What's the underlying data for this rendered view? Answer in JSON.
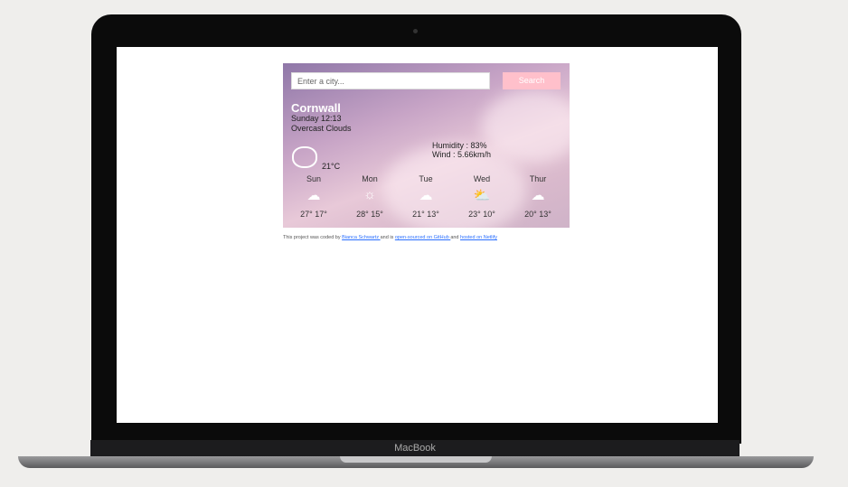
{
  "device": {
    "brand": "MacBook"
  },
  "search": {
    "placeholder": "Enter a city...",
    "button": "Search"
  },
  "current": {
    "city": "Cornwall",
    "datetime": "Sunday 12:13",
    "description": "Overcast Clouds",
    "temperature": "21°C",
    "humidity": "Humidity : 83%",
    "wind": "Wind : 5.66km/h",
    "icon": "cloud-icon"
  },
  "forecast": [
    {
      "day": "Sun",
      "icon": "cloud-icon",
      "temps": "27° 17°"
    },
    {
      "day": "Mon",
      "icon": "sun-icon",
      "temps": "28° 15°"
    },
    {
      "day": "Tue",
      "icon": "cloud-icon",
      "temps": "21° 13°"
    },
    {
      "day": "Wed",
      "icon": "partly-cloudy-icon",
      "temps": "23° 10°"
    },
    {
      "day": "Thur",
      "icon": "cloud-icon",
      "temps": "20° 13°"
    }
  ],
  "footer": {
    "text1": "This project was coded by ",
    "author": "Bianca Schwartz ",
    "text2": "and is ",
    "github": "open-sourced on GitHub ",
    "text3": "and ",
    "netlify": "hosted on Netlify"
  },
  "colors": {
    "button": "#ffc0cb",
    "link": "#2a6fff"
  }
}
